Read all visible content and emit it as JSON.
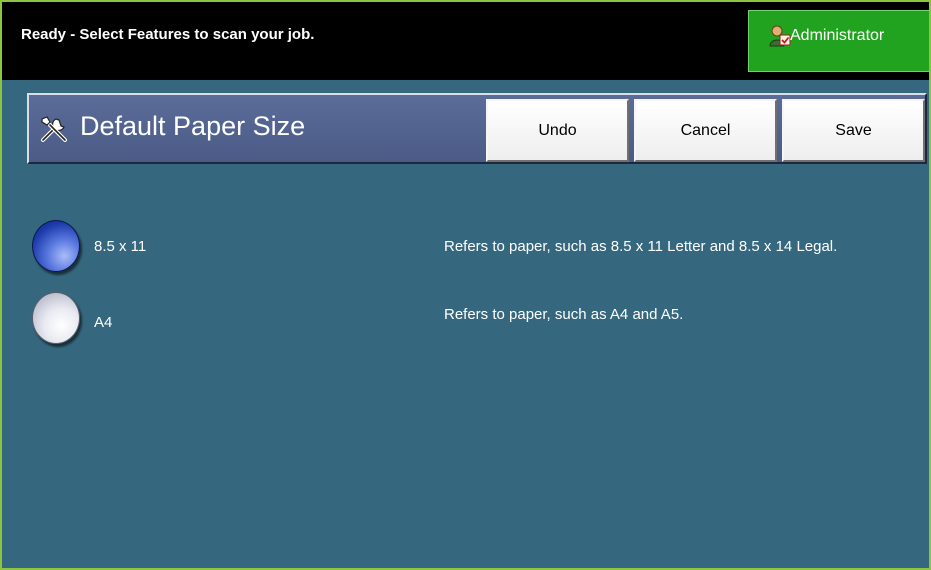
{
  "status_bar": {
    "message": "Ready - Select Features to scan your job.",
    "admin_label": "Administrator",
    "admin_icon": "administrator-user-icon"
  },
  "header": {
    "title": "Default Paper Size",
    "title_icon": "tools-icon",
    "undo_label": "Undo",
    "cancel_label": "Cancel",
    "save_label": "Save"
  },
  "options": [
    {
      "label": "8.5 x 11",
      "description": "Refers to paper, such as 8.5 x 11 Letter and 8.5 x 14 Legal.",
      "selected": true
    },
    {
      "label": "A4",
      "description": "Refers to paper, such as A4 and A5.",
      "selected": false
    }
  ],
  "colors": {
    "frame_border": "#8cc63f",
    "background": "#35687e",
    "status_bar": "#000000",
    "admin_button": "#22a31f",
    "title_panel": "#4b5b86"
  }
}
